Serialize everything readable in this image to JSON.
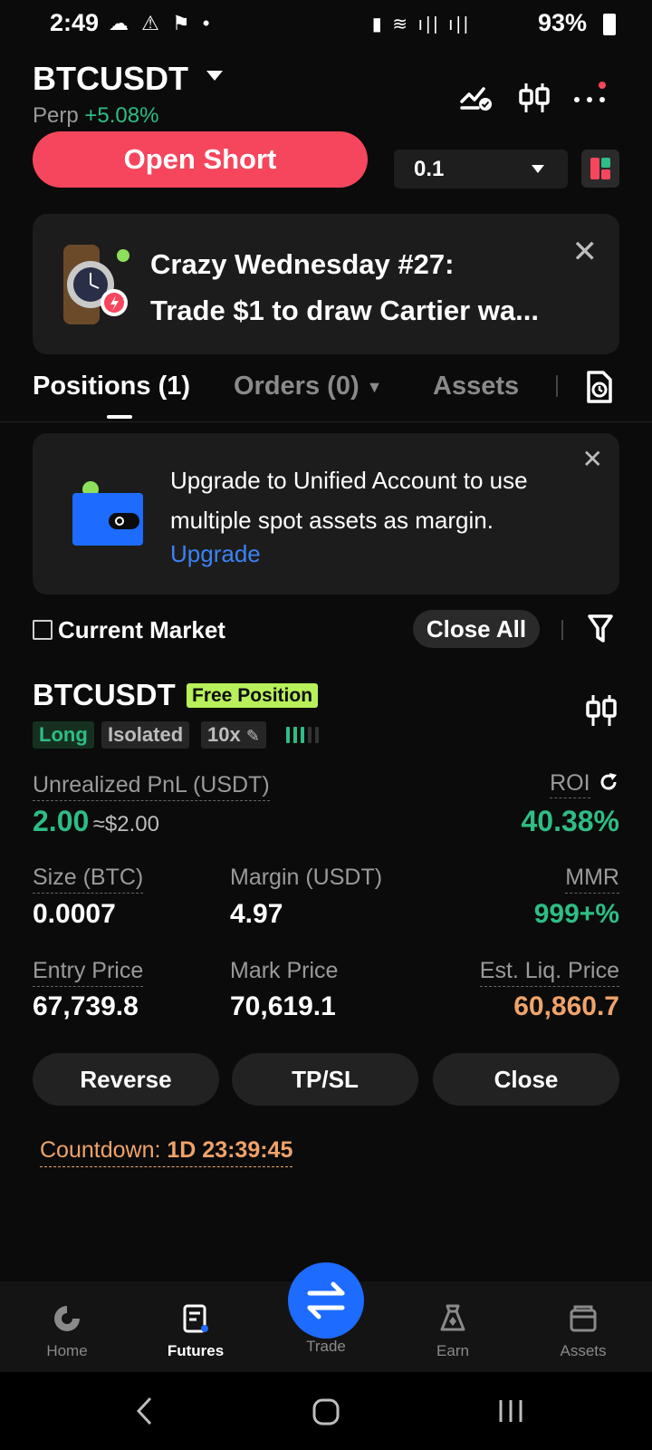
{
  "status_bar": {
    "time": "2:49",
    "battery": "93%"
  },
  "header": {
    "symbol": "BTCUSDT",
    "contract_type": "Perp",
    "change": "+5.08%",
    "open_short_label": "Open Short",
    "quantity": "0.1"
  },
  "promo": {
    "line1": "Crazy Wednesday #27:",
    "line2": "Trade $1 to draw Cartier wa..."
  },
  "tabs": [
    {
      "label": "Positions (1)"
    },
    {
      "label": "Orders (0)"
    },
    {
      "label": "Assets"
    }
  ],
  "upgrade_card": {
    "line1": "Upgrade to Unified Account to use",
    "line2": "multiple spot assets as margin.",
    "link": "Upgrade"
  },
  "filter": {
    "current_market_label": "Current Market",
    "close_all_label": "Close All"
  },
  "position": {
    "symbol": "BTCUSDT",
    "badge": "Free Position",
    "side": "Long",
    "margin_mode": "Isolated",
    "leverage": "10x",
    "unrealized_pnl_label": "Unrealized PnL (USDT)",
    "unrealized_pnl": "2.00",
    "unrealized_pnl_usd": "≈$2.00",
    "roi_label": "ROI",
    "roi": "40.38%",
    "size_label": "Size (BTC)",
    "size": "0.0007",
    "margin_label": "Margin (USDT)",
    "margin": "4.97",
    "mmr_label": "MMR",
    "mmr": "999+%",
    "entry_price_label": "Entry Price",
    "entry_price": "67,739.8",
    "mark_price_label": "Mark Price",
    "mark_price": "70,619.1",
    "liq_price_label": "Est. Liq. Price",
    "liq_price": "60,860.7"
  },
  "actions": {
    "reverse": "Reverse",
    "tpsl": "TP/SL",
    "close": "Close"
  },
  "countdown": {
    "label": "Countdown:",
    "value": "1D 23:39:45"
  },
  "bottom_nav": [
    {
      "label": "Home"
    },
    {
      "label": "Futures"
    },
    {
      "label": "Trade"
    },
    {
      "label": "Earn"
    },
    {
      "label": "Assets"
    }
  ],
  "colors": {
    "green": "#2ebd85",
    "red": "#f6465d",
    "orange": "#f0a36a",
    "blue": "#1e6bff"
  }
}
